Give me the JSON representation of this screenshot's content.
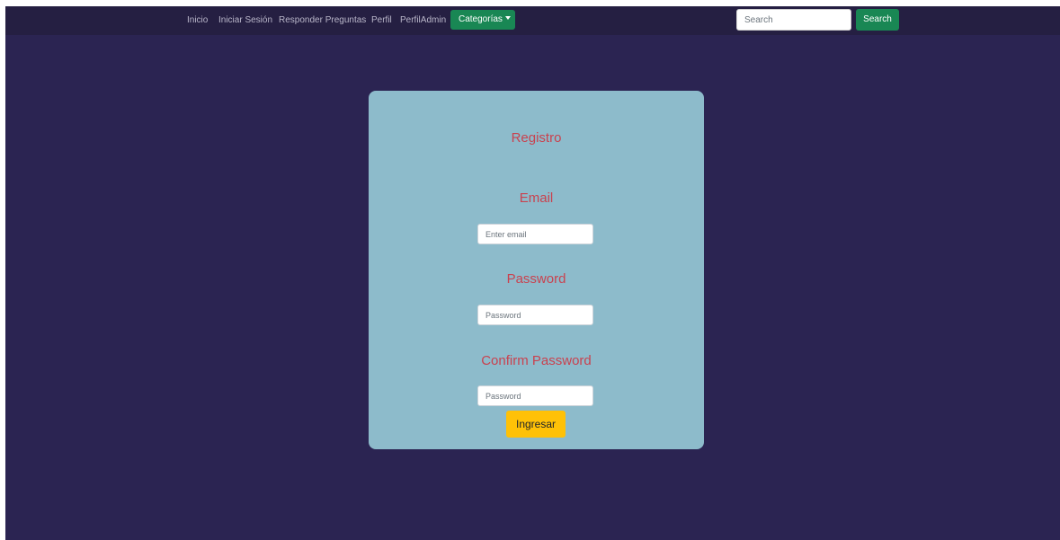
{
  "colors": {
    "page_background": "#2b2452",
    "navbar_background": "#251f42",
    "card_background": "#8dbbcb",
    "heading_color": "#c9424f",
    "primary_green": "#198754",
    "submit_yellow": "#ffc107"
  },
  "navbar": {
    "links": [
      "Inicio",
      "Iniciar Sesión",
      "Responder Preguntas",
      "Perfil",
      "PerfilAdmin"
    ],
    "dropdown_label": "Categorías",
    "dropdown_icon": "caret-down-icon",
    "search": {
      "placeholder": "Search",
      "value": "",
      "button_label": "Search"
    }
  },
  "form": {
    "title": "Registro",
    "email": {
      "label": "Email",
      "placeholder": "Enter email",
      "value": ""
    },
    "password": {
      "label": "Password",
      "placeholder": "Password",
      "value": ""
    },
    "confirm_password": {
      "label": "Confirm Password",
      "placeholder": "Password",
      "value": ""
    },
    "submit_label": "Ingresar"
  }
}
